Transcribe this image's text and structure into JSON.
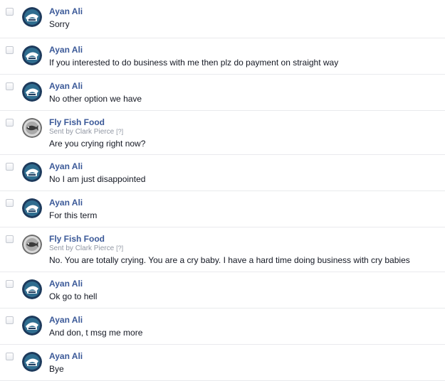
{
  "messages": [
    {
      "sender": "Ayan Ali",
      "text": "Sorry",
      "avatar": "ayan-logo"
    },
    {
      "sender": "Ayan Ali",
      "text": "If you interested to do business with me then plz do payment on straight way",
      "avatar": "ayan-logo"
    },
    {
      "sender": "Ayan Ali",
      "text": "No other option we have",
      "avatar": "ayan-logo"
    },
    {
      "sender": "Fly Fish Food",
      "sent_by": "Sent by Clark Pierce",
      "help": "[?]",
      "text": "Are you crying right now?",
      "avatar": "flyfish-logo"
    },
    {
      "sender": "Ayan Ali",
      "text": "No I am just disappointed",
      "avatar": "ayan-logo"
    },
    {
      "sender": "Ayan Ali",
      "text": "For this term",
      "avatar": "ayan-logo"
    },
    {
      "sender": "Fly Fish Food",
      "sent_by": "Sent by Clark Pierce",
      "help": "[?]",
      "text": "No.  You are totally crying.  You are a cry baby.  I have a hard time doing business with cry babies",
      "avatar": "flyfish-logo"
    },
    {
      "sender": "Ayan Ali",
      "text": "Ok go to hell",
      "avatar": "ayan-logo"
    },
    {
      "sender": "Ayan Ali",
      "text": "And don, t msg me more",
      "avatar": "ayan-logo"
    },
    {
      "sender": "Ayan Ali",
      "text": "Bye",
      "avatar": "ayan-logo"
    }
  ],
  "colors": {
    "sender_link": "#3b5998",
    "message_text": "#141823",
    "meta_text": "#9197a3",
    "divider": "#e9eaed"
  }
}
